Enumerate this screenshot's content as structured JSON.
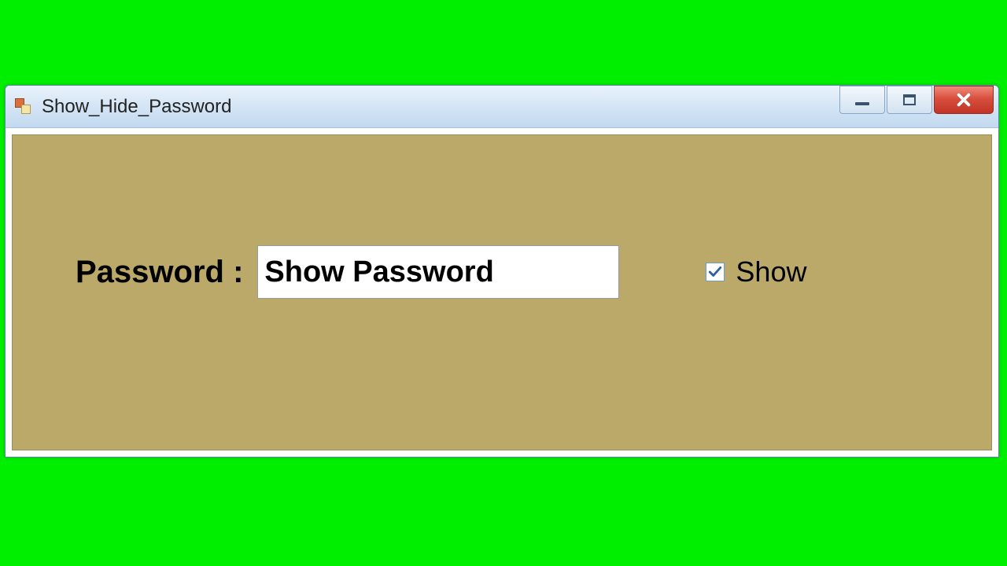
{
  "window": {
    "title": "Show_Hide_Password"
  },
  "form": {
    "password_label": "Password :",
    "password_value": "Show Password",
    "show_checkbox_label": "Show",
    "show_checked": true
  }
}
